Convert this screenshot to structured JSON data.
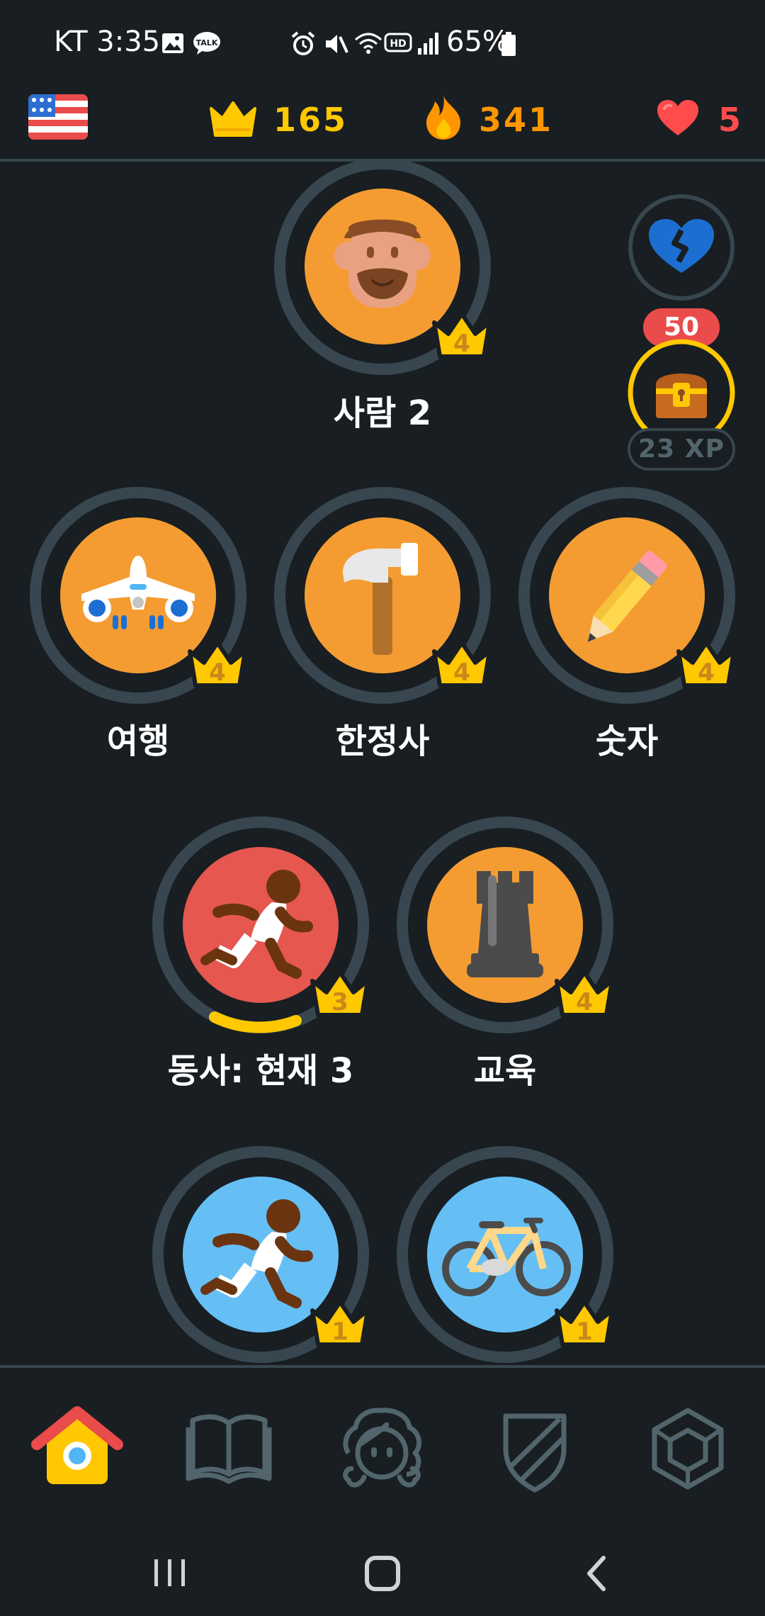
{
  "status_bar": {
    "carrier_time": "KT 3:35",
    "battery": "65%"
  },
  "top_bar": {
    "course_flag": "us-flag-icon",
    "crowns": "165",
    "streak": "341",
    "hearts": "5",
    "colors": {
      "crowns": "#ffc800",
      "streak": "#ff9600",
      "hearts": "#ff4b4b"
    }
  },
  "side_items": {
    "heart_refill_cost": "50",
    "chest_xp": "23 XP"
  },
  "skills": [
    {
      "label": "사람 2",
      "level": "4",
      "icon": "bearded-man-icon",
      "color": "#f49c32"
    },
    {
      "label": "여행",
      "level": "4",
      "icon": "airplane-icon",
      "color": "#f49c32"
    },
    {
      "label": "한정사",
      "level": "4",
      "icon": "hammer-icon",
      "color": "#f49c32"
    },
    {
      "label": "숫자",
      "level": "4",
      "icon": "pencil-icon",
      "color": "#f49c32"
    },
    {
      "label": "동사: 현재 3",
      "level": "3",
      "icon": "running-man-icon",
      "color": "#e5574f",
      "progress": 0.25
    },
    {
      "label": "교육",
      "level": "4",
      "icon": "chess-rook-icon",
      "color": "#f49c32"
    },
    {
      "label": "",
      "level": "1",
      "icon": "running-man-icon",
      "color": "#65bff5"
    },
    {
      "label": "",
      "level": "1",
      "icon": "bicycle-icon",
      "color": "#65bff5"
    }
  ],
  "bottom_nav": [
    {
      "name": "home",
      "icon": "home-icon",
      "active": true
    },
    {
      "name": "stories",
      "icon": "book-icon",
      "active": false
    },
    {
      "name": "profile",
      "icon": "avatar-icon",
      "active": false
    },
    {
      "name": "leagues",
      "icon": "shield-icon",
      "active": false
    },
    {
      "name": "shop",
      "icon": "hexagon-icon",
      "active": false
    }
  ]
}
